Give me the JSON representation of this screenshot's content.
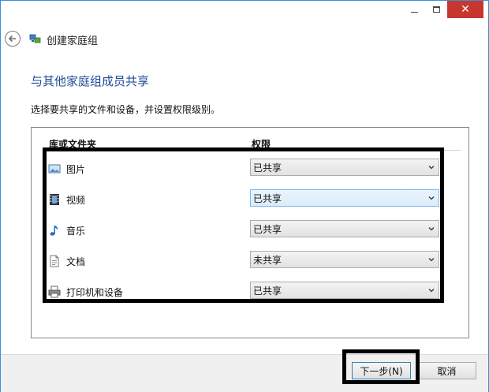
{
  "window": {
    "close_glyph": "✕"
  },
  "nav": {
    "title": "创建家庭组",
    "back_icon": "back-arrow-icon",
    "app_icon": "homegroup-icon"
  },
  "main": {
    "heading": "与其他家庭组成员共享",
    "description": "选择要共享的文件和设备，并设置权限级别。",
    "columns": {
      "library": "库或文件夹",
      "permission": "权限"
    },
    "rows": [
      {
        "label": "图片",
        "icon": "pictures-icon",
        "permission": "已共享"
      },
      {
        "label": "视频",
        "icon": "videos-icon",
        "permission": "已共享"
      },
      {
        "label": "音乐",
        "icon": "music-icon",
        "permission": "已共享"
      },
      {
        "label": "文档",
        "icon": "documents-icon",
        "permission": "未共享"
      },
      {
        "label": "打印机和设备",
        "icon": "printer-icon",
        "permission": "已共享"
      }
    ]
  },
  "footer": {
    "next_label": "下一步(N)",
    "cancel_label": "取消"
  },
  "colors": {
    "heading": "#1e4a96",
    "close_button": "#c7372f",
    "highlight": "#000000"
  }
}
